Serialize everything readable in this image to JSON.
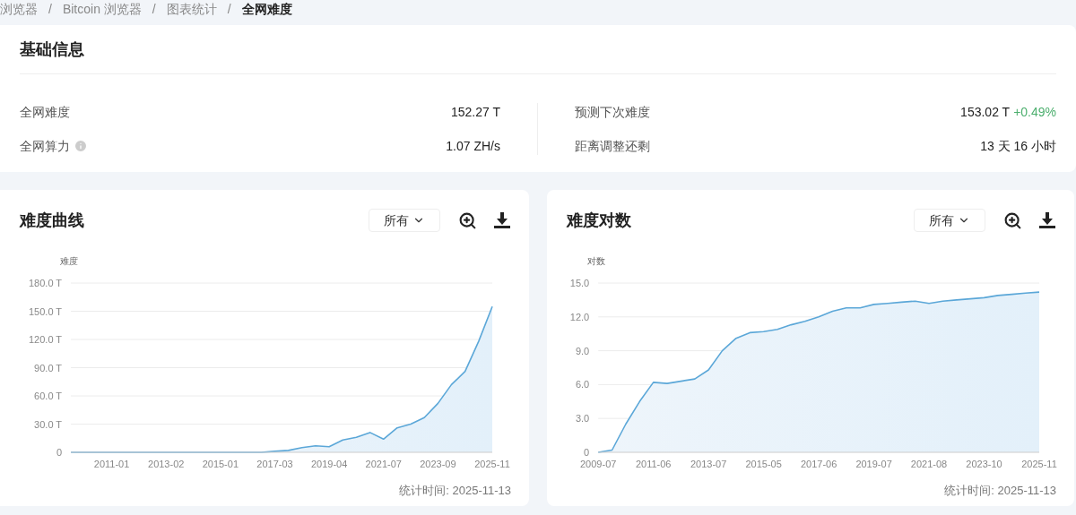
{
  "breadcrumb": {
    "separator": "/",
    "items": [
      {
        "label": "浏览器",
        "current": false
      },
      {
        "label": "Bitcoin 浏览器",
        "current": false
      },
      {
        "label": "图表统计",
        "current": false
      },
      {
        "label": "全网难度",
        "current": true
      }
    ]
  },
  "basic_info": {
    "title": "基础信息",
    "columns": [
      [
        {
          "label": "全网难度",
          "value": "152.27 T",
          "info": false
        },
        {
          "label": "全网算力",
          "value": "1.07 ZH/s",
          "info": true
        }
      ],
      [
        {
          "label": "预测下次难度",
          "value": "153.02 T",
          "change": "+0.49%",
          "info": false
        },
        {
          "label": "距离调整还剩",
          "value": "13 天 16 小时",
          "info": false
        }
      ]
    ]
  },
  "charts": [
    {
      "title": "难度曲线",
      "range": "所有",
      "footer": "统计时间: 2025-11-13",
      "chart_data": {
        "type": "area",
        "categories": [
          null,
          null,
          null,
          "2011-01",
          null,
          null,
          null,
          "2013-02",
          null,
          null,
          null,
          "2015-01",
          null,
          null,
          null,
          "2017-03",
          null,
          null,
          null,
          "2019-04",
          null,
          null,
          null,
          "2021-07",
          null,
          null,
          null,
          "2023-09",
          null,
          null,
          null,
          "2025-11"
        ],
        "series": [
          {
            "name": "难度",
            "color": "#5ba7d8",
            "values": [
              0,
              0,
              0,
              0,
              0,
              0,
              0,
              0,
              0,
              0,
              0,
              0,
              0,
              0,
              0,
              1,
              2,
              5,
              7,
              6,
              13,
              16,
              21,
              14,
              26,
              30,
              37,
              52,
              72,
              86,
              118,
              155
            ]
          }
        ],
        "ylim": [
          0,
          180
        ],
        "grid": true,
        "yticks": [
          {
            "value": 0,
            "label": "0"
          },
          {
            "value": 30,
            "label": "30.0 T"
          },
          {
            "value": 60,
            "label": "60.0 T"
          },
          {
            "value": 90,
            "label": "90.0 T"
          },
          {
            "value": 120,
            "label": "120.0 T"
          },
          {
            "value": 150,
            "label": "150.0 T"
          },
          {
            "value": 180,
            "label": "180.0 T"
          }
        ]
      }
    },
    {
      "title": "难度对数",
      "range": "所有",
      "footer": "统计时间: 2025-11-13",
      "chart_data": {
        "type": "area",
        "categories": [
          "2009-07",
          null,
          null,
          null,
          "2011-06",
          null,
          null,
          null,
          "2013-07",
          null,
          null,
          null,
          "2015-05",
          null,
          null,
          null,
          "2017-06",
          null,
          null,
          null,
          "2019-07",
          null,
          null,
          null,
          "2021-08",
          null,
          null,
          null,
          "2023-10",
          null,
          null,
          null,
          "2025-11"
        ],
        "series": [
          {
            "name": "对数",
            "color": "#5ba7d8",
            "values": [
              0,
              0.2,
              2.5,
              4.5,
              6.2,
              6.1,
              6.3,
              6.5,
              7.3,
              9,
              10.1,
              10.6,
              10.7,
              10.9,
              11.3,
              11.6,
              12,
              12.5,
              12.8,
              12.8,
              13.1,
              13.2,
              13.3,
              13.4,
              13.2,
              13.4,
              13.5,
              13.6,
              13.7,
              13.9,
              14,
              14.1,
              14.2
            ]
          }
        ],
        "ylim": [
          0,
          15
        ],
        "grid": true,
        "yticks": [
          {
            "value": 0,
            "label": "0"
          },
          {
            "value": 3,
            "label": "3.0"
          },
          {
            "value": 6,
            "label": "6.0"
          },
          {
            "value": 9,
            "label": "9.0"
          },
          {
            "value": 12,
            "label": "12.0"
          },
          {
            "value": 15,
            "label": "15.0"
          }
        ]
      }
    }
  ]
}
